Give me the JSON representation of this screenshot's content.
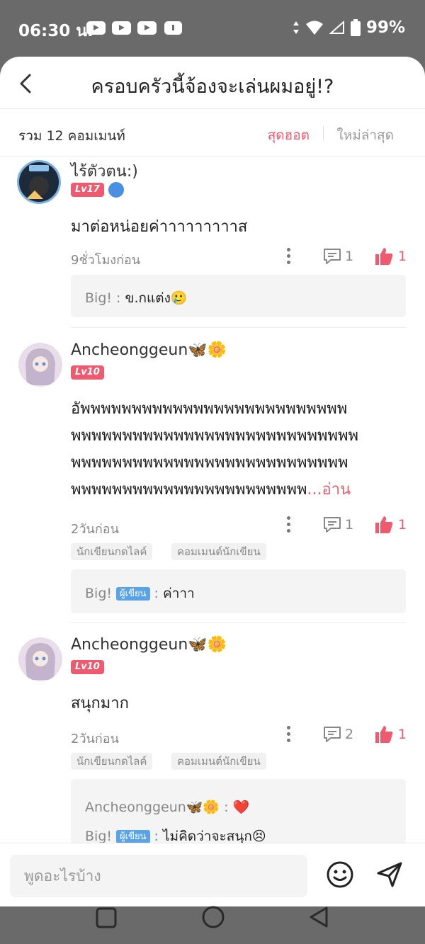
{
  "status_bar": {
    "time": "06:30 น.",
    "battery": "99%"
  },
  "header": {
    "title": "ครอบครัวนี้จ้องจะเล่นผมอยู่!?"
  },
  "count_bar": {
    "total": "รวม 12 คอมเมนท์",
    "sort_hot": "สุดฮอต",
    "sort_new": "ใหม่ล่าสุด"
  },
  "comments": [
    {
      "name": "ไร้ตัวตน:)",
      "level": "Lv17",
      "text": "มาต่อหน่อยค่าาาาาาาาาส",
      "time": "9ชั่วโมงก่อน",
      "reply_count": "1",
      "like_count": "1",
      "reply": {
        "author": "Big!",
        "sep": " : ",
        "text": "ข.กแต่ง🥲"
      }
    },
    {
      "name": "Ancheonggeun🦋🌼",
      "level": "Lv10",
      "lines": [
        "อัพพพพพพพพพพพพพพพพพพพพพพพพพพ",
        "พพพพพพพพพพพพพพพพพพพพพพพพพพพพ",
        "พพพพพพพพพพพพพพพพพพพพพพพพพพพ",
        "พพพพพพพพพพพพพพพพพพพพพพพ"
      ],
      "more": "...อ่าน",
      "time": "2วันก่อน",
      "reply_count": "1",
      "like_count": "1",
      "tags": [
        "นักเขียนกดไลค์",
        "คอมเมนต์นักเขียน"
      ],
      "reply": {
        "author": "Big!",
        "writer_tag": "ผู้เขียน",
        "sep": " : ",
        "text": "ค่าาา"
      }
    },
    {
      "name": "Ancheonggeun🦋🌼",
      "level": "Lv10",
      "text": "สนุกมาก",
      "time": "2วันก่อน",
      "reply_count": "2",
      "like_count": "1",
      "tags": [
        "นักเขียนกดไลค์",
        "คอมเมนต์นักเขียน"
      ],
      "replies": [
        {
          "author": "Ancheonggeun🦋🌼",
          "sep": " : ",
          "text": "❤️"
        },
        {
          "author": "Big!",
          "writer_tag": "ผู้เขียน",
          "sep": " : ",
          "text": "ไม่คิดว่าจะสนุก😣"
        }
      ]
    }
  ],
  "composer": {
    "placeholder": "พูดอะไรบ้าง"
  },
  "colors": {
    "accent": "#f05a6e",
    "writer_tag": "#5aa3e8",
    "status_bar": "#6a6a6a"
  }
}
